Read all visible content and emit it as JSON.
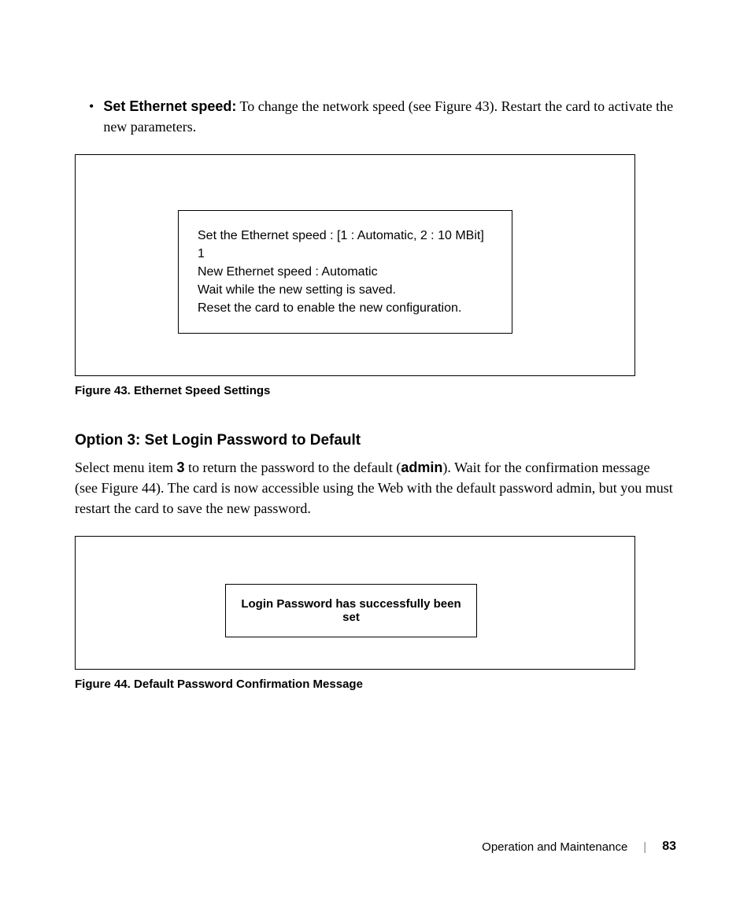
{
  "bullet": {
    "glyph": "•",
    "lead": "Set Ethernet speed:",
    "rest": " To change the network speed (see Figure 43). Restart the card to activate the new parameters."
  },
  "figure43": {
    "lines": {
      "l1": "Set the Ethernet speed : [1 : Automatic, 2 : 10 MBit]",
      "l2": "1",
      "l3": "New Ethernet speed : Automatic",
      "l4": "Wait while the new setting is saved.",
      "l5": "Reset the card to enable the new configuration."
    },
    "caption": "Figure 43. Ethernet Speed Settings"
  },
  "section_heading": "Option 3: Set Login Password to Default",
  "para": {
    "p1a": "Select menu item ",
    "p1b_bold": "3",
    "p1c": " to return the password to the default (",
    "p1d_bold": "admin",
    "p1e": "). Wait for the confirmation message (see Figure 44). The card is now accessible using the Web with the default password admin, but you must restart the card to save the new password."
  },
  "figure44": {
    "message": "Login Password has successfully been set",
    "caption": "Figure 44. Default Password Confirmation Message"
  },
  "footer": {
    "section": "Operation and Maintenance",
    "divider": "|",
    "page": "83"
  }
}
